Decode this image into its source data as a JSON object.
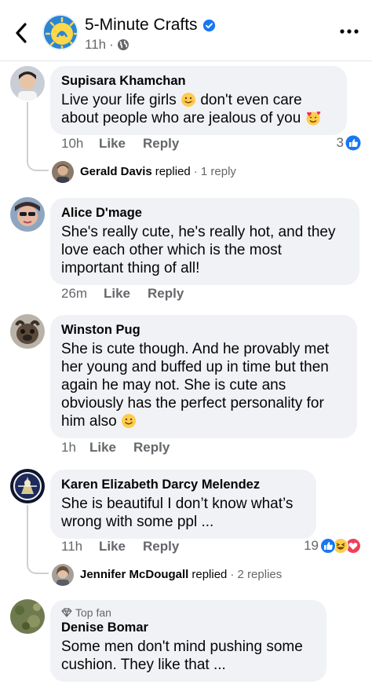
{
  "header": {
    "page_name": "5-Minute Crafts",
    "time": "11h",
    "separator": "·"
  },
  "comments": [
    {
      "author": "Supisara Khamchan",
      "text_a": "Live your life girls",
      "text_b": "don't even care",
      "text_c": "about people who are jealous of you",
      "time": "10h",
      "like": "Like",
      "reply": "Reply",
      "reaction_count": "3",
      "replied": {
        "name": "Gerald Davis",
        "verb": "replied",
        "count": "· 1 reply"
      }
    },
    {
      "author": "Alice D'mage",
      "lines": [
        "She's really cute, he's really hot, and they",
        "love each other which is the most",
        "important thing of all!"
      ],
      "time": "26m",
      "like": "Like",
      "reply": "Reply"
    },
    {
      "author": "Winston Pug",
      "lines": [
        "She is cute though. And he provably met",
        "her young and buffed up in time but then",
        "again he may not. She is cute ans",
        "obviously has the perfect personality for"
      ],
      "last_line": "him also",
      "time": "1h",
      "like": "Like",
      "reply": "Reply"
    },
    {
      "author": "Karen Elizabeth Darcy Melendez",
      "lines": [
        "She is beautiful I don’t know what’s",
        "wrong with some ppl ..."
      ],
      "time": "11h",
      "like": "Like",
      "reply": "Reply",
      "reaction_count": "19",
      "replied": {
        "name": "Jennifer McDougall",
        "verb": "replied",
        "count": "· 2 replies"
      }
    },
    {
      "badge": "Top fan",
      "author": "Denise Bomar",
      "lines": [
        "Some men don't mind pushing some",
        "cushion.  They like that ..."
      ]
    }
  ],
  "colors": {
    "bubble": "#f0f2f5",
    "secondary_text": "#65676b",
    "like_blue": "#1877f2",
    "heart_red": "#f33e58"
  },
  "icons": [
    "back-chevron-icon",
    "page-logo-icon",
    "verified-badge-icon",
    "globe-icon",
    "more-dots-icon",
    "like-reaction-icon",
    "haha-reaction-icon",
    "love-reaction-icon",
    "diamond-icon"
  ]
}
